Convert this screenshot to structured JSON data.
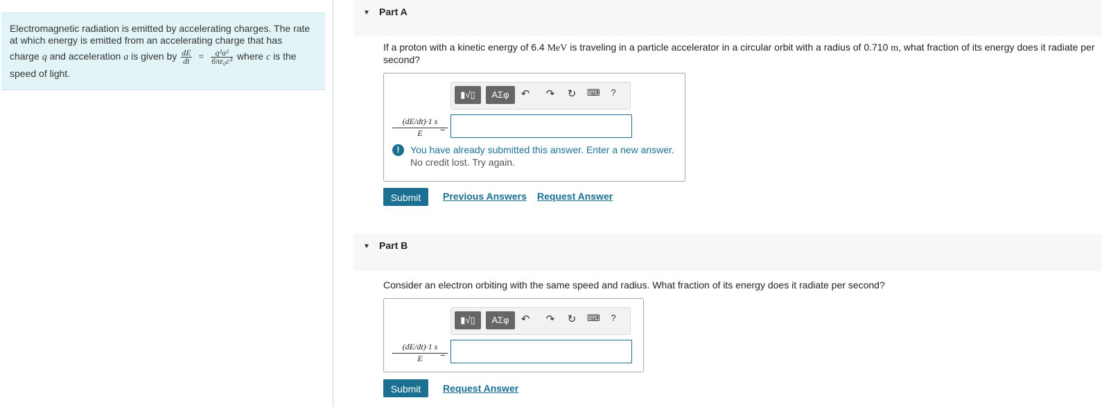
{
  "intro": {
    "line1": "Electromagnetic radiation is emitted by accelerating charges. The rate",
    "line2": "at which energy is emitted from an accelerating charge that has",
    "line3_a": "charge ",
    "q": "q",
    "line3_b": " and acceleration ",
    "a": "a",
    "line3_c": " is given by ",
    "dE": "dE",
    "dt": "dt",
    "equals": "=",
    "num": "q²a²",
    "den": "6πε₀c³",
    "line3_d": " where ",
    "c": "c",
    "line3_e": " is the",
    "line4": "speed of light."
  },
  "partA": {
    "title": "Part A",
    "question_a": "If a proton with a kinetic energy of 6.4 ",
    "unit_mev": "MeV",
    "question_b": " is traveling in a particle accelerator in a circular orbit with a radius of 0.710 ",
    "unit_m": "m",
    "question_c": ", what fraction of its energy does it radiate per",
    "question_d": "second?",
    "lhs_num": "(dE/dt)·1 s",
    "lhs_den": "E",
    "equals": "=",
    "input_value": "",
    "feedback_main": "You have already submitted this answer. Enter a new answer.",
    "feedback_sub": "No credit lost. Try again.",
    "submit": "Submit",
    "previous_answers": "Previous Answers",
    "request_answer": "Request Answer"
  },
  "partB": {
    "title": "Part B",
    "question": "Consider an electron orbiting with the same speed and radius. What fraction of its energy does it radiate per second?",
    "lhs_num": "(dE/dt)·1 s",
    "lhs_den": "E",
    "equals": "=",
    "input_value": "",
    "submit": "Submit",
    "request_answer": "Request Answer"
  },
  "toolbar": {
    "greek": "ΑΣφ",
    "help": "?",
    "icons": [
      "templates-icon",
      "greek-symbols-icon",
      "undo-icon",
      "redo-icon",
      "reset-icon",
      "keyboard-icon",
      "help-icon"
    ]
  },
  "colors": {
    "accent": "#1b6f91",
    "intro_bg": "#e2f4f5",
    "header_bg": "#f7f7f7"
  }
}
